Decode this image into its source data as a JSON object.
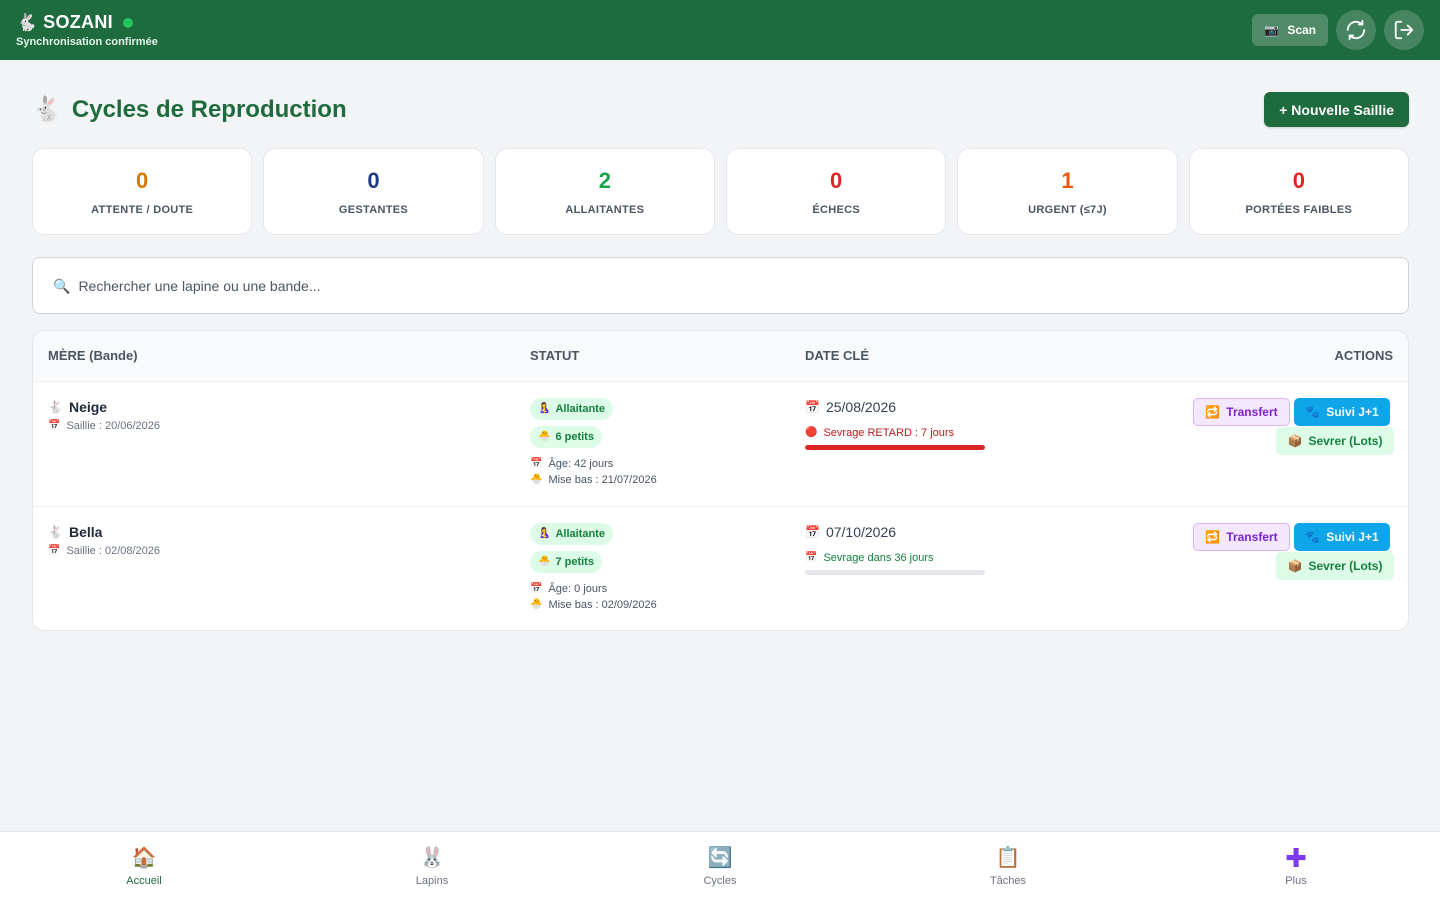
{
  "header": {
    "app_name": "SOZANI",
    "sync_status": "Synchronisation confirmée",
    "scan_label": "Scan",
    "scan_icon": "camera-icon",
    "colors": {
      "bar": "#1e6b3d",
      "online": "#22c55e"
    }
  },
  "page": {
    "title": "Cycles de Reproduction",
    "new_button": "+ Nouvelle Saillie"
  },
  "stats": [
    {
      "value": "0",
      "label": "ATTENTE / DOUTE",
      "color": "#d97706"
    },
    {
      "value": "0",
      "label": "GESTANTES",
      "color": "#1e3a8a"
    },
    {
      "value": "2",
      "label": "ALLAITANTES",
      "color": "#16a34a"
    },
    {
      "value": "0",
      "label": "ÉCHECS",
      "color": "#dc2626"
    },
    {
      "value": "1",
      "label": "URGENT (≤7J)",
      "color": "#ea580c"
    },
    {
      "value": "0",
      "label": "PORTÉES FAIBLES",
      "color": "#dc2626"
    }
  ],
  "search": {
    "placeholder": "Rechercher une lapine ou une bande..."
  },
  "table": {
    "headers": {
      "mother": "MÈRE (Bande)",
      "status": "STATUT",
      "date": "DATE CLÉ",
      "actions": "ACTIONS"
    },
    "rows": [
      {
        "name": "Neige",
        "saillie": "Saillie : 20/06/2026",
        "status": "Allaitante",
        "litter": "6 petits",
        "age": "Âge: 42 jours",
        "birth": "Mise bas : 21/07/2026",
        "date": "25/08/2026",
        "note": "Sevrage RETARD : 7 jours",
        "note_color": "#b91c1c",
        "progress": 1.0,
        "progress_color": "#dc2626",
        "transfer": "Transfert",
        "suivi": "Suivi J+1",
        "sevrer": "Sevrer (Lots)"
      },
      {
        "name": "Bella",
        "saillie": "Saillie : 02/08/2026",
        "status": "Allaitante",
        "litter": "7 petits",
        "age": "Âge: 0 jours",
        "birth": "Mise bas : 02/09/2026",
        "date": "07/10/2026",
        "note": "Sevrage dans 36 jours",
        "note_color": "#15803d",
        "progress": 0.0,
        "progress_color": "#16a34a",
        "transfer": "Transfert",
        "suivi": "Suivi J+1",
        "sevrer": "Sevrer (Lots)"
      }
    ]
  },
  "nav": [
    {
      "label": "Accueil",
      "icon": "house-icon",
      "active": true
    },
    {
      "label": "Lapins",
      "icon": "rabbit-icon",
      "active": false
    },
    {
      "label": "Cycles",
      "icon": "cycle-icon",
      "active": false
    },
    {
      "label": "Tâches",
      "icon": "clipboard-icon",
      "active": false
    },
    {
      "label": "Plus",
      "icon": "plus-icon",
      "active": false
    }
  ]
}
